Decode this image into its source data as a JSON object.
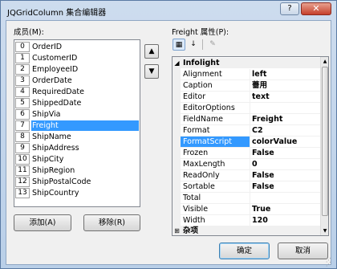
{
  "window": {
    "title": "JQGridColumn 集合编辑器",
    "help_label": "?",
    "close_label": "✕"
  },
  "members": {
    "label": "成员(M):",
    "items": [
      {
        "index": "0",
        "name": "OrderID"
      },
      {
        "index": "1",
        "name": "CustomerID"
      },
      {
        "index": "2",
        "name": "EmployeeID"
      },
      {
        "index": "3",
        "name": "OrderDate"
      },
      {
        "index": "4",
        "name": "RequiredDate"
      },
      {
        "index": "5",
        "name": "ShippedDate"
      },
      {
        "index": "6",
        "name": "ShipVia"
      },
      {
        "index": "7",
        "name": "Freight"
      },
      {
        "index": "8",
        "name": "ShipName"
      },
      {
        "index": "9",
        "name": "ShipAddress"
      },
      {
        "index": "10",
        "name": "ShipCity"
      },
      {
        "index": "11",
        "name": "ShipRegion"
      },
      {
        "index": "12",
        "name": "ShipPostalCode"
      },
      {
        "index": "13",
        "name": "ShipCountry"
      }
    ],
    "selected_index": 7,
    "move_up_icon": "arrow-up-icon",
    "move_down_icon": "arrow-down-icon",
    "add_label": "添加(A)",
    "remove_label": "移除(R)"
  },
  "properties": {
    "label": "Freight 属性(P):",
    "toolbar": {
      "categorized_icon": "categorized-icon",
      "alphabetical_icon": "alphabetical-icon",
      "property_pages_icon": "wrench-icon"
    },
    "category_infolight": "Infolight",
    "category_misc": "杂项",
    "rows": [
      {
        "name": "Alignment",
        "value": "left"
      },
      {
        "name": "Caption",
        "value": "薔用"
      },
      {
        "name": "Editor",
        "value": "text"
      },
      {
        "name": "EditorOptions",
        "value": ""
      },
      {
        "name": "FieldName",
        "value": "Freight"
      },
      {
        "name": "Format",
        "value": "C2"
      },
      {
        "name": "FormatScript",
        "value": "colorValue"
      },
      {
        "name": "Frozen",
        "value": "False"
      },
      {
        "name": "MaxLength",
        "value": "0"
      },
      {
        "name": "ReadOnly",
        "value": "False"
      },
      {
        "name": "Sortable",
        "value": "False"
      },
      {
        "name": "Total",
        "value": ""
      },
      {
        "name": "Visible",
        "value": "True"
      },
      {
        "name": "Width",
        "value": "120"
      }
    ],
    "selected_row": 6,
    "collapse_glyph": "◢",
    "expand_glyph": "⊞"
  },
  "footer": {
    "ok_label": "确定",
    "cancel_label": "取消"
  },
  "colors": {
    "selection": "#3399ff",
    "window_frame": "#b9cfe8",
    "client": "#f0f0f0"
  }
}
